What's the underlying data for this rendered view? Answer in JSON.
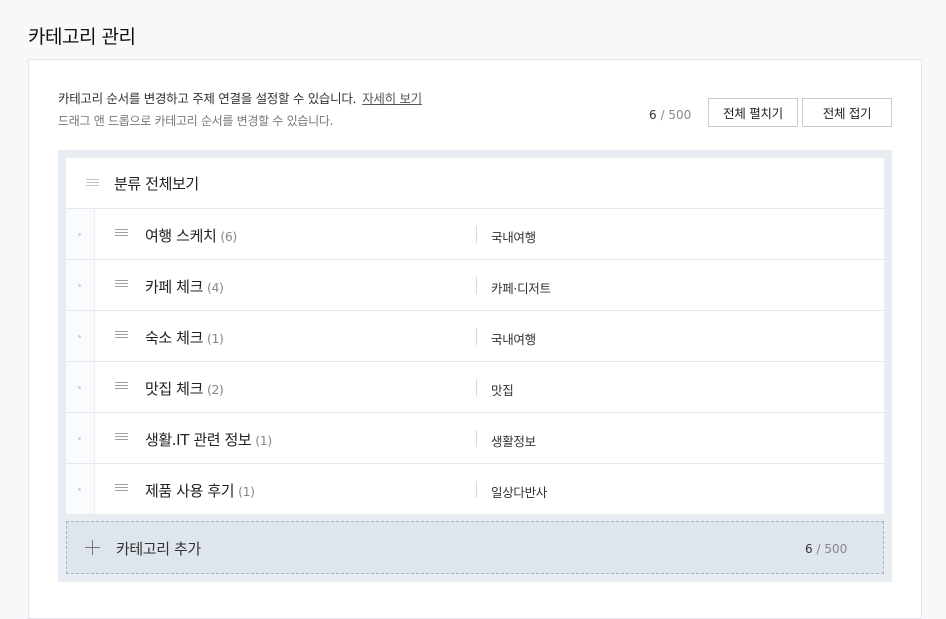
{
  "page": {
    "title": "카테고리 관리"
  },
  "description": {
    "main": "카테고리 순서를 변경하고 주제 연결을 설정할 수 있습니다.",
    "more_link": "자세히 보기",
    "sub": "드래그 앤 드롭으로 카테고리 순서를 변경할 수 있습니다."
  },
  "counter": {
    "current": "6",
    "max": "/ 500"
  },
  "buttons": {
    "expand_all": "전체 펼치기",
    "collapse_all": "전체 접기"
  },
  "root": {
    "label": "분류 전체보기"
  },
  "categories": [
    {
      "name": "여행 스케치",
      "count": "(6)",
      "topic": "국내여행"
    },
    {
      "name": "카페 체크",
      "count": "(4)",
      "topic": "카페·디저트"
    },
    {
      "name": "숙소 체크",
      "count": "(1)",
      "topic": "국내여행"
    },
    {
      "name": "맛집 체크",
      "count": "(2)",
      "topic": "맛집"
    },
    {
      "name": "생활.IT 관련 정보",
      "count": "(1)",
      "topic": "생활정보"
    },
    {
      "name": "제품 사용 후기",
      "count": "(1)",
      "topic": "일상다반사"
    }
  ],
  "add_category": {
    "label": "카테고리 추가",
    "current": "6",
    "max": "/ 500"
  }
}
